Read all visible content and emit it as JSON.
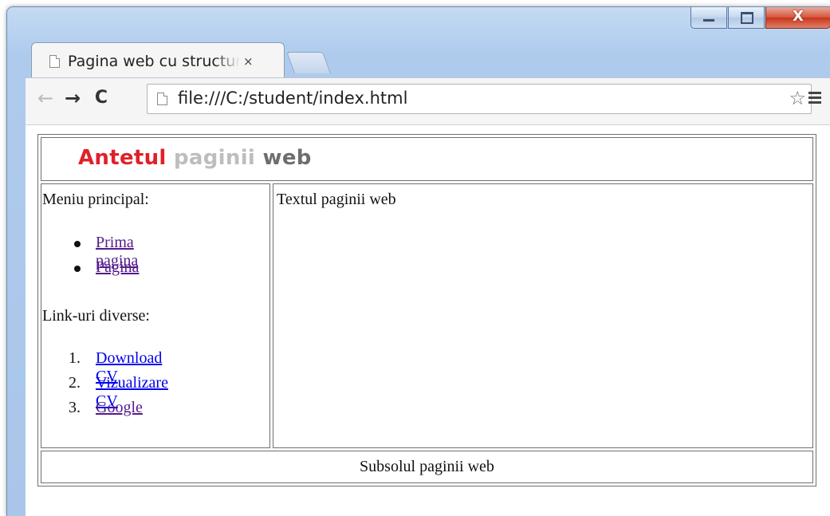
{
  "browser": {
    "tab_title": "Pagina web cu structura",
    "tab_close": "×",
    "url": "file:///C:/student/index.html"
  },
  "page": {
    "header": {
      "part1": "Antetul",
      "part2": "paginii",
      "part3": "web"
    },
    "menu_label": "Meniu principal:",
    "menu_items": [
      "Prima pagina",
      "Pagina"
    ],
    "links_label": "Link-uri diverse:",
    "link_items": [
      {
        "num": "1.",
        "label": "Download CV"
      },
      {
        "num": "2.",
        "label": "Vizualizare CV"
      },
      {
        "num": "3.",
        "label": "Google"
      }
    ],
    "content_text": "Textul paginii web",
    "footer_text": "Subsolul paginii web"
  },
  "colors": {
    "header_red": "#e0202a",
    "header_grey": "#bdbdbd",
    "header_dark": "#6e6e6e",
    "link": "#0000ee",
    "visited": "#551a8b"
  }
}
